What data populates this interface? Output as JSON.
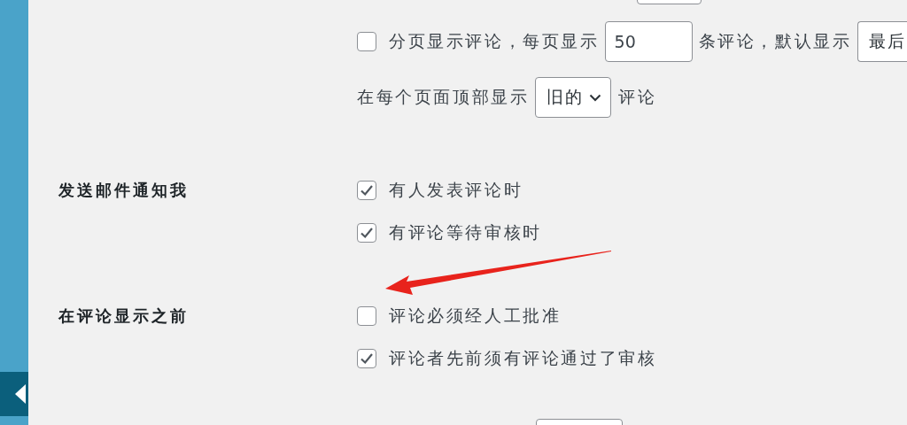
{
  "sections": [
    {
      "lines": [
        [
          {
            "kind": "checkbox",
            "checked": false
          },
          {
            "kind": "text",
            "text": "分页显示评论，每页显示"
          },
          {
            "kind": "input",
            "value": "50"
          },
          {
            "kind": "text",
            "text": "条评论，默认显示"
          },
          {
            "kind": "select",
            "value": "最后",
            "cut": true
          }
        ],
        [
          {
            "kind": "text",
            "text": "在每个页面顶部显示"
          },
          {
            "kind": "select",
            "value": "旧的"
          },
          {
            "kind": "text",
            "text": "评论"
          }
        ]
      ]
    },
    {
      "label": "发送邮件通知我",
      "lines": [
        [
          {
            "kind": "checkbox",
            "checked": true
          },
          {
            "kind": "text",
            "text": "有人发表评论时"
          }
        ],
        [
          {
            "kind": "checkbox",
            "checked": true
          },
          {
            "kind": "text",
            "text": "有评论等待审核时"
          }
        ]
      ]
    },
    {
      "label": "在评论显示之前",
      "lines": [
        [
          {
            "kind": "checkbox",
            "checked": false
          },
          {
            "kind": "text",
            "text": "评论必须经人工批准"
          }
        ],
        [
          {
            "kind": "checkbox",
            "checked": true
          },
          {
            "kind": "text",
            "text": "评论者先前须有评论通过了审核"
          }
        ]
      ]
    }
  ]
}
